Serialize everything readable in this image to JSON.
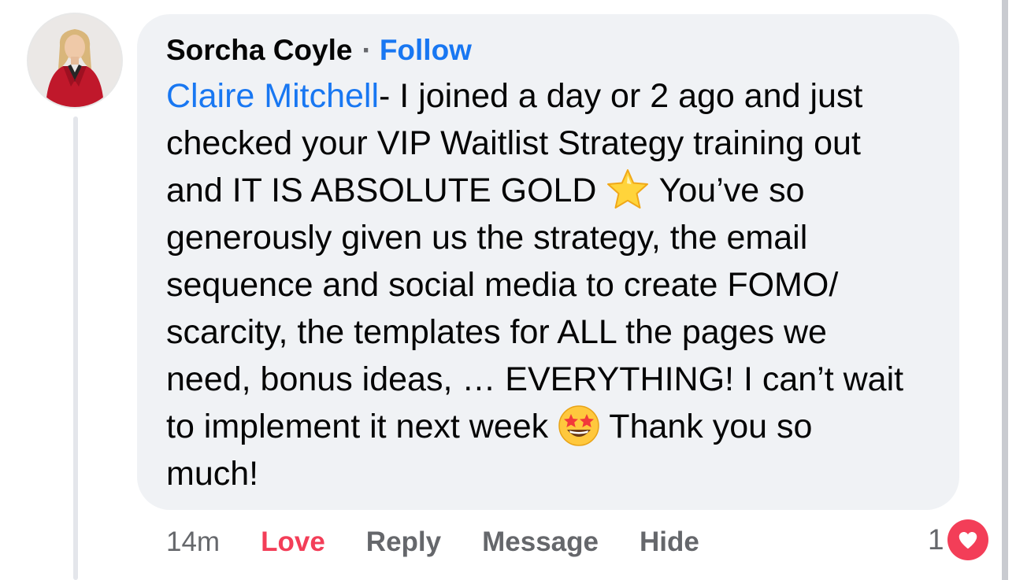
{
  "comment": {
    "author": "Sorcha Coyle",
    "separator": "·",
    "follow_label": "Follow",
    "mention": "Claire Mitchell",
    "body_lines": [
      "- I joined a day or 2 ago and just",
      "checked your VIP Waitlist Strategy training out",
      "and IT IS ABSOLUTE GOLD",
      "You’ve so",
      "generously given us the strategy, the email",
      "sequence and social media to create FOMO/",
      "scarcity, the templates for ALL the pages we",
      "need, bonus ideas, … EVERYTHING! I can’t wait",
      "to implement it next week",
      "Thank you so",
      "much!"
    ],
    "emojis": [
      "star-emoji",
      "star-struck-emoji"
    ]
  },
  "actions": {
    "timestamp": "14m",
    "love_label": "Love",
    "reply_label": "Reply",
    "message_label": "Message",
    "hide_label": "Hide"
  },
  "reactions": {
    "count": "1",
    "icon": "heart-icon"
  },
  "colors": {
    "link_blue": "#1877f2",
    "love_red": "#f33e58",
    "bubble_bg": "#f0f2f5",
    "secondary_text": "#65676b"
  }
}
